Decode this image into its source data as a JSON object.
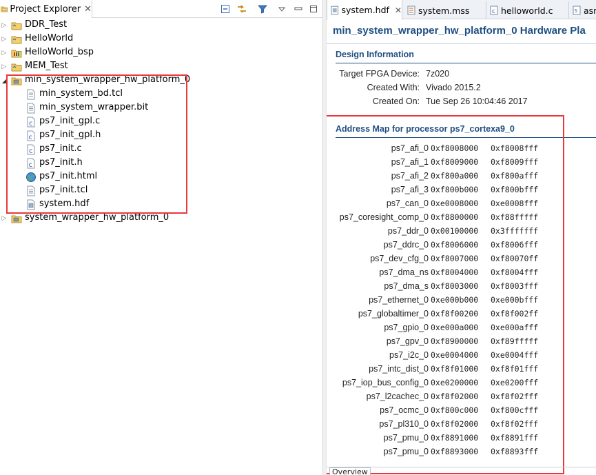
{
  "explorer": {
    "tab_label": "Project Explorer",
    "tab_close": "✕",
    "toolbar": [
      {
        "name": "collapse-all-icon"
      },
      {
        "name": "link-with-editor-icon"
      },
      {
        "name": "filter-icon"
      },
      {
        "name": "view-menu-icon"
      },
      {
        "name": "minimize-icon"
      },
      {
        "name": "maximize-icon"
      }
    ],
    "items": [
      {
        "label": "DDR_Test",
        "indent": 0,
        "expanded": false,
        "icon": "folder-project-icon"
      },
      {
        "label": "HelloWorld",
        "indent": 0,
        "expanded": false,
        "icon": "folder-project-icon"
      },
      {
        "label": "HelloWorld_bsp",
        "indent": 0,
        "expanded": false,
        "icon": "bsp-project-icon"
      },
      {
        "label": "MEM_Test",
        "indent": 0,
        "expanded": false,
        "icon": "folder-project-icon"
      },
      {
        "label": "min_system_wrapper_hw_platform_0",
        "indent": 0,
        "expanded": true,
        "icon": "hw-platform-icon"
      },
      {
        "label": "min_system_bd.tcl",
        "indent": 1,
        "icon": "file-text-icon"
      },
      {
        "label": "min_system_wrapper.bit",
        "indent": 1,
        "icon": "file-text-icon"
      },
      {
        "label": "ps7_init_gpl.c",
        "indent": 1,
        "icon": "file-c-icon"
      },
      {
        "label": "ps7_init_gpl.h",
        "indent": 1,
        "icon": "file-h-icon"
      },
      {
        "label": "ps7_init.c",
        "indent": 1,
        "icon": "file-c-icon"
      },
      {
        "label": "ps7_init.h",
        "indent": 1,
        "icon": "file-h-icon"
      },
      {
        "label": "ps7_init.html",
        "indent": 1,
        "icon": "file-html-icon"
      },
      {
        "label": "ps7_init.tcl",
        "indent": 1,
        "icon": "file-text-icon"
      },
      {
        "label": "system.hdf",
        "indent": 1,
        "icon": "file-hdf-icon"
      },
      {
        "label": "system_wrapper_hw_platform_0",
        "indent": 0,
        "expanded": false,
        "icon": "hw-platform-icon"
      }
    ]
  },
  "editor": {
    "tabs": [
      {
        "label": "system.hdf",
        "active": true,
        "icon": "file-hdf-icon",
        "close": "✕"
      },
      {
        "label": "system.mss",
        "active": false,
        "icon": "file-mss-icon"
      },
      {
        "label": "helloworld.c",
        "active": false,
        "icon": "file-c-icon"
      },
      {
        "label": "asm",
        "active": false,
        "icon": "file-asm-icon"
      }
    ],
    "title": "min_system_wrapper_hw_platform_0 Hardware Pla",
    "design_info": {
      "heading": "Design Information",
      "fields": [
        {
          "key": "Target FPGA Device:",
          "value": "7z020"
        },
        {
          "key": "Created With:",
          "value": "Vivado 2015.2"
        },
        {
          "key": "Created On:",
          "value": "Tue Sep 26 10:04:46 2017"
        }
      ]
    },
    "address_map": {
      "heading": "Address Map for processor ps7_cortexa9_0",
      "rows": [
        {
          "name": "ps7_afi_0",
          "base": "0xf8008000",
          "high": "0xf8008fff"
        },
        {
          "name": "ps7_afi_1",
          "base": "0xf8009000",
          "high": "0xf8009fff"
        },
        {
          "name": "ps7_afi_2",
          "base": "0xf800a000",
          "high": "0xf800afff"
        },
        {
          "name": "ps7_afi_3",
          "base": "0xf800b000",
          "high": "0xf800bfff"
        },
        {
          "name": "ps7_can_0",
          "base": "0xe0008000",
          "high": "0xe0008fff"
        },
        {
          "name": "ps7_coresight_comp_0",
          "base": "0xf8800000",
          "high": "0xf88fffff"
        },
        {
          "name": "ps7_ddr_0",
          "base": "0x00100000",
          "high": "0x3fffffff"
        },
        {
          "name": "ps7_ddrc_0",
          "base": "0xf8006000",
          "high": "0xf8006fff"
        },
        {
          "name": "ps7_dev_cfg_0",
          "base": "0xf8007000",
          "high": "0xf80070ff"
        },
        {
          "name": "ps7_dma_ns",
          "base": "0xf8004000",
          "high": "0xf8004fff"
        },
        {
          "name": "ps7_dma_s",
          "base": "0xf8003000",
          "high": "0xf8003fff"
        },
        {
          "name": "ps7_ethernet_0",
          "base": "0xe000b000",
          "high": "0xe000bfff"
        },
        {
          "name": "ps7_globaltimer_0",
          "base": "0xf8f00200",
          "high": "0xf8f002ff"
        },
        {
          "name": "ps7_gpio_0",
          "base": "0xe000a000",
          "high": "0xe000afff"
        },
        {
          "name": "ps7_gpv_0",
          "base": "0xf8900000",
          "high": "0xf89fffff"
        },
        {
          "name": "ps7_i2c_0",
          "base": "0xe0004000",
          "high": "0xe0004fff"
        },
        {
          "name": "ps7_intc_dist_0",
          "base": "0xf8f01000",
          "high": "0xf8f01fff"
        },
        {
          "name": "ps7_iop_bus_config_0",
          "base": "0xe0200000",
          "high": "0xe0200fff"
        },
        {
          "name": "ps7_l2cachec_0",
          "base": "0xf8f02000",
          "high": "0xf8f02fff"
        },
        {
          "name": "ps7_ocmc_0",
          "base": "0xf800c000",
          "high": "0xf800cfff"
        },
        {
          "name": "ps7_pl310_0",
          "base": "0xf8f02000",
          "high": "0xf8f02fff"
        },
        {
          "name": "ps7_pmu_0",
          "base": "0xf8891000",
          "high": "0xf8891fff"
        },
        {
          "name": "ps7_pmu_0",
          "base": "0xf8893000",
          "high": "0xf8893fff"
        }
      ]
    },
    "bottom_tab": "Overview"
  },
  "colors": {
    "heading_blue": "#1f4e82",
    "highlight_red": "#e8383b"
  }
}
